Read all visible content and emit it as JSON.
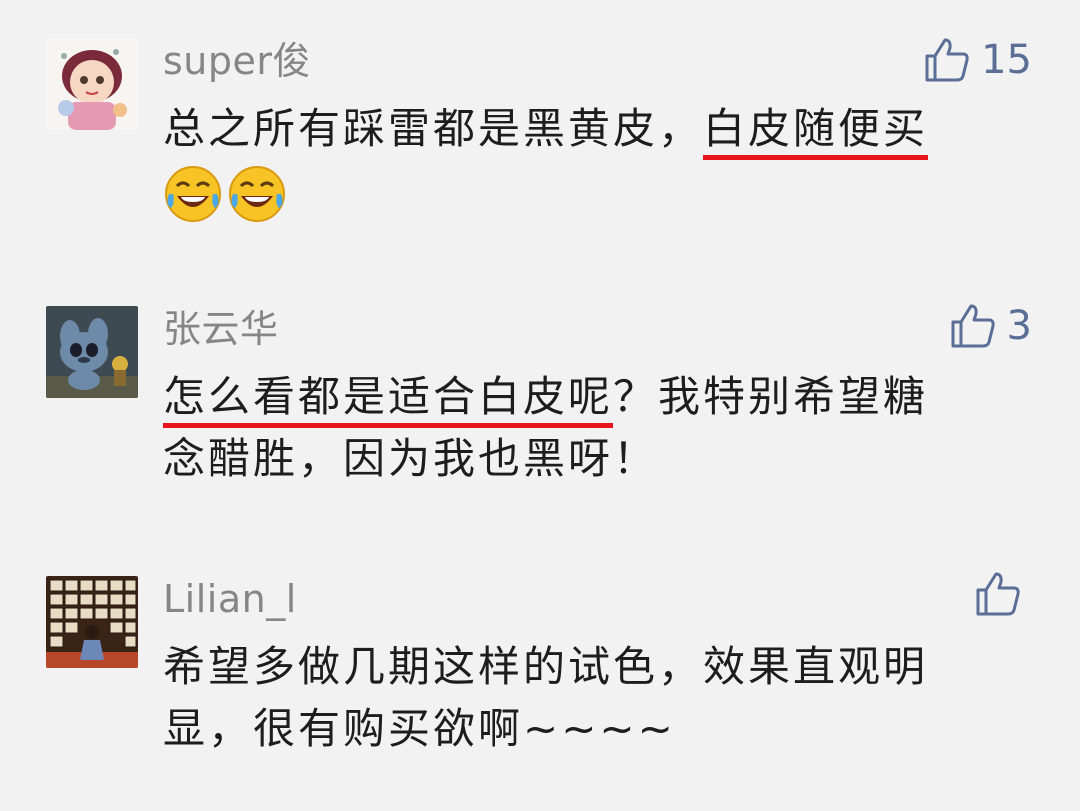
{
  "comments": [
    {
      "name": "super俊",
      "likes": "15",
      "text_plain": "总之所有踩雷都是黑黄皮，",
      "text_highlight": "白皮随便买",
      "emoji": [
        "joy-emoji",
        "joy-emoji"
      ],
      "avatar_icon": "cartoon-girl-avatar"
    },
    {
      "name": "张云华",
      "likes": "3",
      "text_highlight": "怎么看都是适合白皮呢",
      "text_rest_line1": "？我特别希望糖",
      "text_line2": "念醋胜，因为我也黑呀！",
      "avatar_icon": "stitch-figure-avatar"
    },
    {
      "name": "Lilian_l",
      "likes": "",
      "text_line1": "希望多做几期这样的试色，效果直观明",
      "text_line2": "显，很有购买欲啊~~~~",
      "avatar_icon": "drawer-wall-photo-avatar"
    }
  ],
  "colors": {
    "background": "#f2f2f3",
    "name": "#868686",
    "like": "#5a6e96",
    "text": "#1d1d1d",
    "underline": "#e8141b"
  }
}
